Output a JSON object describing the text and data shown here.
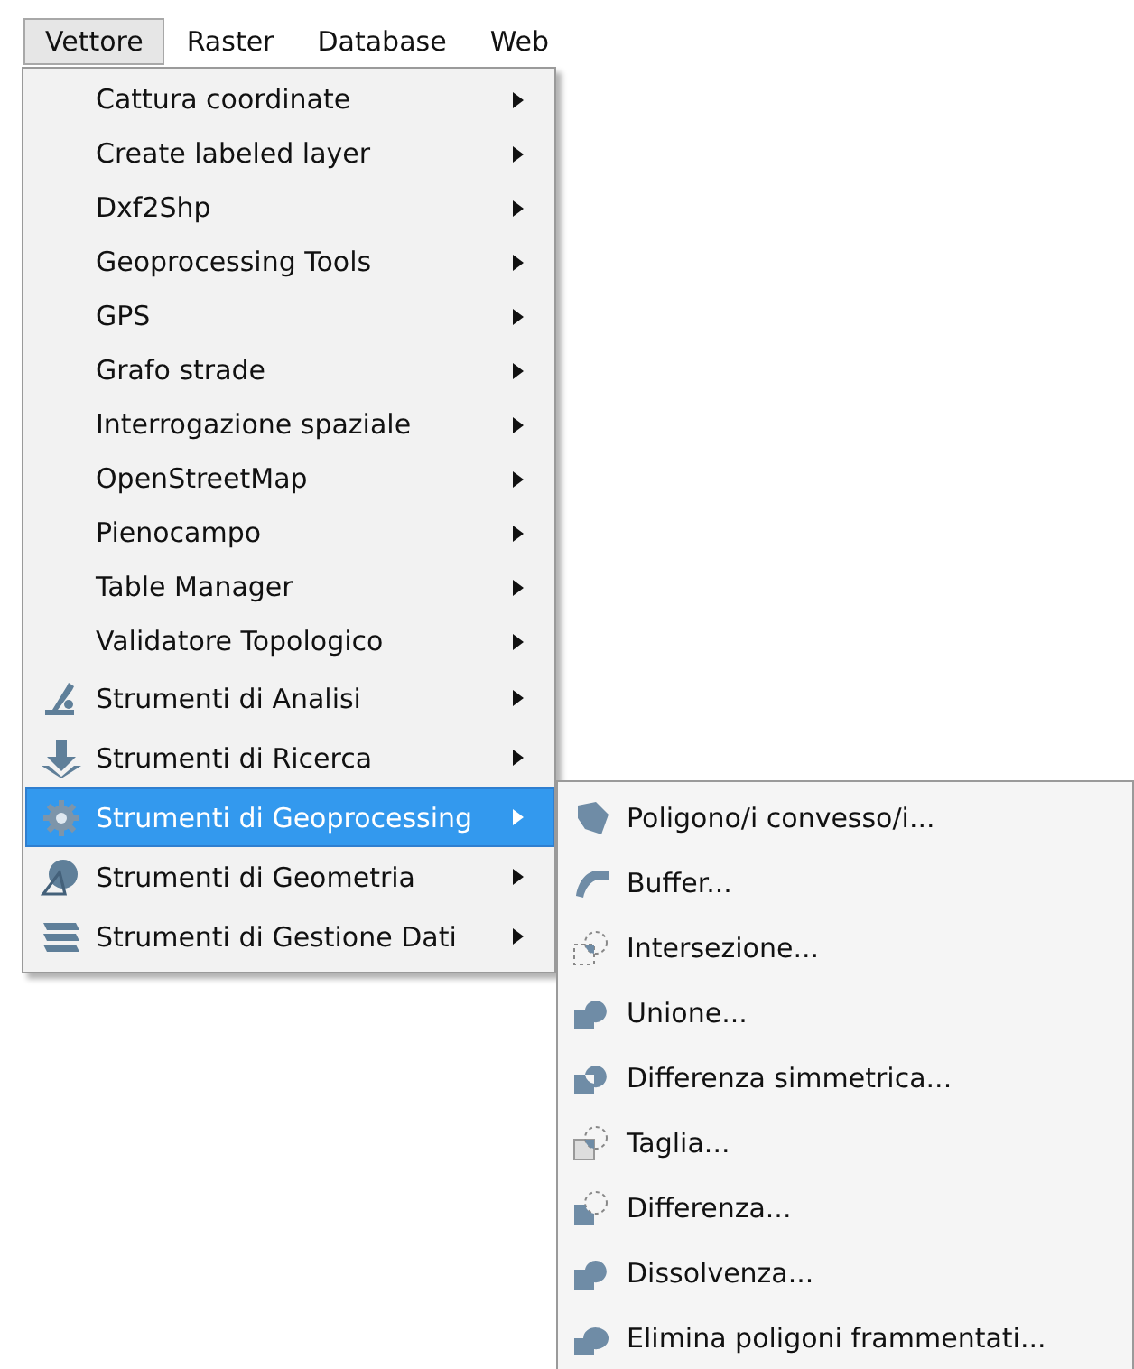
{
  "menubar": [
    {
      "label": "Vettore",
      "selected": true
    },
    {
      "label": "Raster",
      "selected": false
    },
    {
      "label": "Database",
      "selected": false
    },
    {
      "label": "Web",
      "selected": false
    }
  ],
  "menu": {
    "items": [
      {
        "label": "Cattura coordinate",
        "kind": "plain",
        "selected": false
      },
      {
        "label": "Create labeled layer",
        "kind": "plain",
        "selected": false
      },
      {
        "label": "Dxf2Shp",
        "kind": "plain",
        "selected": false
      },
      {
        "label": "Geoprocessing Tools",
        "kind": "plain",
        "selected": false
      },
      {
        "label": "GPS",
        "kind": "plain",
        "selected": false
      },
      {
        "label": "Grafo strade",
        "kind": "plain",
        "selected": false
      },
      {
        "label": "Interrogazione spaziale",
        "kind": "plain",
        "selected": false
      },
      {
        "label": "OpenStreetMap",
        "kind": "plain",
        "selected": false
      },
      {
        "label": "Pienocampo",
        "kind": "plain",
        "selected": false
      },
      {
        "label": "Table Manager",
        "kind": "plain",
        "selected": false
      },
      {
        "label": "Validatore Topologico",
        "kind": "plain",
        "selected": false
      },
      {
        "label": "Strumenti di Analisi",
        "kind": "tool",
        "selected": false
      },
      {
        "label": "Strumenti di Ricerca",
        "kind": "tool",
        "selected": false
      },
      {
        "label": "Strumenti di Geoprocessing",
        "kind": "tool",
        "selected": true
      },
      {
        "label": "Strumenti di Geometria",
        "kind": "tool",
        "selected": false
      },
      {
        "label": "Strumenti di Gestione Dati",
        "kind": "tool",
        "selected": false
      }
    ]
  },
  "submenu": {
    "items": [
      {
        "label": "Poligono/i convesso/i..."
      },
      {
        "label": "Buffer..."
      },
      {
        "label": "Intersezione..."
      },
      {
        "label": "Unione..."
      },
      {
        "label": "Differenza simmetrica..."
      },
      {
        "label": "Taglia..."
      },
      {
        "label": "Differenza..."
      },
      {
        "label": "Dissolvenza..."
      },
      {
        "label": "Elimina poligoni frammentati..."
      }
    ]
  }
}
